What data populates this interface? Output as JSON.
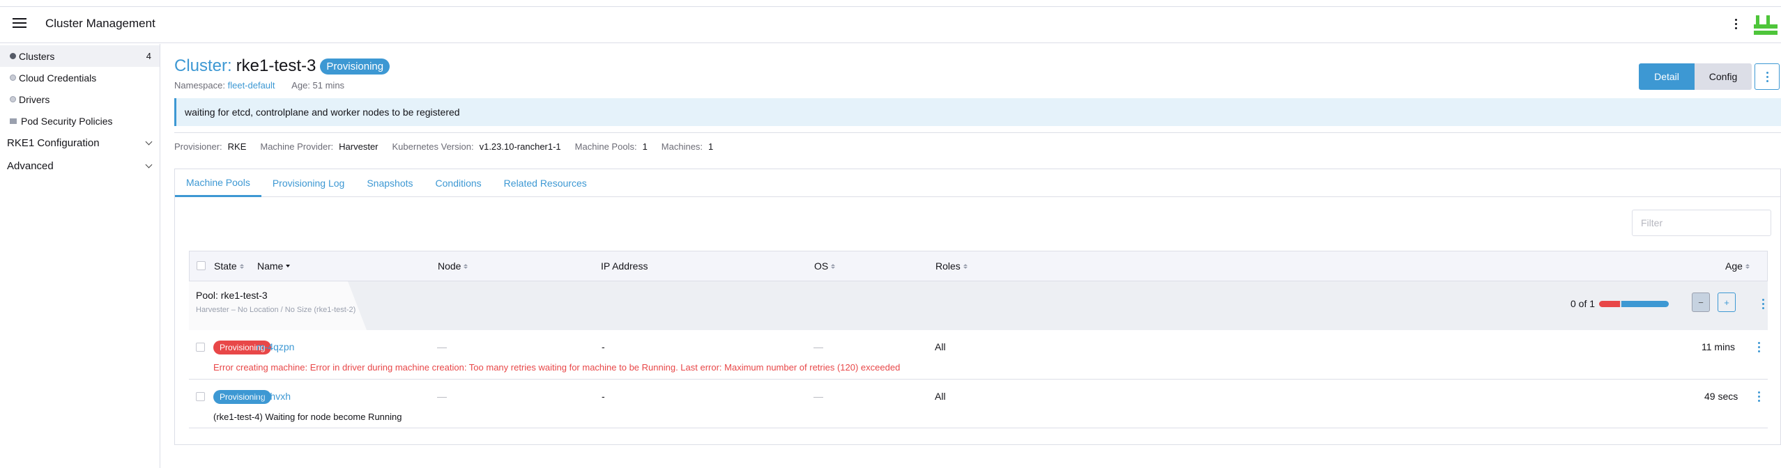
{
  "header": {
    "title": "Cluster Management"
  },
  "sidebar": {
    "items": [
      {
        "label": "Clusters",
        "count": "4"
      },
      {
        "label": "Cloud Credentials"
      },
      {
        "label": "Drivers"
      },
      {
        "label": "Pod Security Policies"
      }
    ],
    "groups": [
      {
        "label": "RKE1 Configuration"
      },
      {
        "label": "Advanced"
      }
    ]
  },
  "cluster": {
    "prefix": "Cluster:",
    "name": "rke1-test-3",
    "status": "Provisioning",
    "namespace_label": "Namespace:",
    "namespace": "fleet-default",
    "age": "Age: 51 mins"
  },
  "actions": {
    "detail": "Detail",
    "config": "Config"
  },
  "banner": "waiting for etcd, controlplane and worker nodes to be registered",
  "info": {
    "provisioner_label": "Provisioner:",
    "provisioner": "RKE",
    "machine_provider_label": "Machine Provider:",
    "machine_provider": "Harvester",
    "k8s_label": "Kubernetes Version:",
    "k8s": "v1.23.10-rancher1-1",
    "pools_label": "Machine Pools:",
    "pools": "1",
    "machines_label": "Machines:",
    "machines": "1"
  },
  "tabs": [
    "Machine Pools",
    "Provisioning Log",
    "Snapshots",
    "Conditions",
    "Related Resources"
  ],
  "filter": {
    "placeholder": "Filter"
  },
  "table": {
    "columns": [
      "State",
      "Name",
      "Node",
      "IP Address",
      "OS",
      "Roles",
      "Age"
    ],
    "group": {
      "title": "Pool: rke1-test-3",
      "subtitle": "Harvester – No Location / No Size (rke1-test-2)",
      "count": "0 of 1",
      "progress": {
        "error_fraction": 0.3,
        "ok_fraction": 0.7
      },
      "minus": "−",
      "plus": "+"
    },
    "rows": [
      {
        "state": "Provisioning",
        "state_color": "#e84748",
        "name": "m-4qzpn",
        "node": "—",
        "ip": "-",
        "os": "—",
        "roles": "All",
        "age": "11 mins",
        "message": "Error creating machine: Error in driver during machine creation: Too many retries waiting for machine to be Running. Last error: Maximum number of retries (120) exceeded"
      },
      {
        "state": "Provisioning",
        "state_color": "#3d98d3",
        "name": "m-lhvxh",
        "node": "—",
        "ip": "-",
        "os": "—",
        "roles": "All",
        "age": "49 secs",
        "message": "(rke1-test-4) Waiting for node become Running"
      }
    ]
  },
  "colors": {
    "accent": "#3d98d3",
    "error": "#e84748",
    "logo": "#4ec53a"
  }
}
